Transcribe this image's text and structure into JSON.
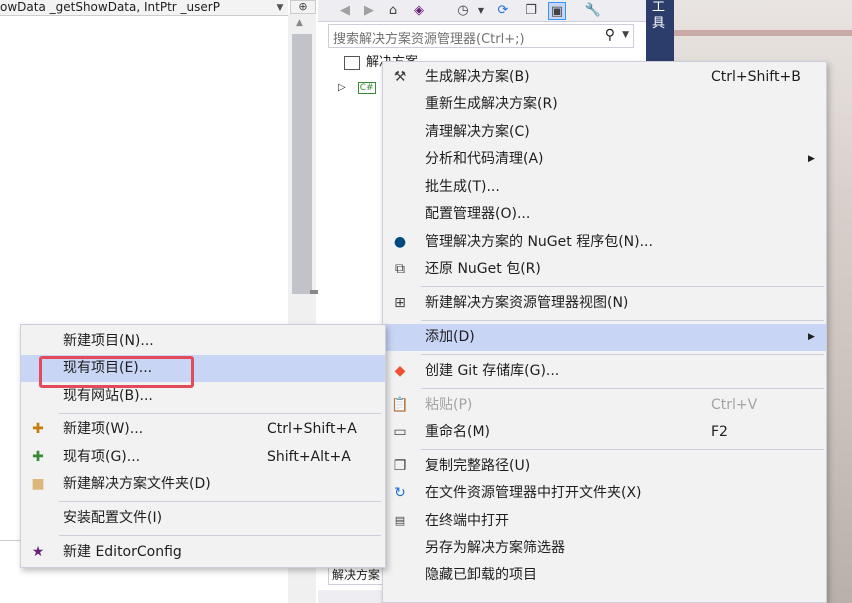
{
  "editor": {
    "code_text": "owData _getShowData, IntPtr _userP"
  },
  "solution_explorer": {
    "search_placeholder": "搜索解决方案资源管理器(Ctrl+;)",
    "tree_root_label": "解决方案 ...",
    "tree_child_badge": "C#",
    "bottom_tab_label": "解决方案"
  },
  "right_strip": {
    "text": "工具"
  },
  "main_menu": {
    "items": [
      {
        "label": "生成解决方案(B)",
        "shortcut": "Ctrl+Shift+B",
        "icon": "build-icon"
      },
      {
        "label": "重新生成解决方案(R)",
        "shortcut": ""
      },
      {
        "label": "清理解决方案(C)",
        "shortcut": ""
      },
      {
        "label": "分析和代码清理(A)",
        "shortcut": "",
        "submenu": true
      },
      {
        "label": "批生成(T)...",
        "shortcut": ""
      },
      {
        "label": "配置管理器(O)...",
        "shortcut": ""
      },
      {
        "label": "管理解决方案的 NuGet 程序包(N)...",
        "shortcut": "",
        "icon": "nuget-icon"
      },
      {
        "label": "还原 NuGet 包(R)",
        "shortcut": "",
        "icon": "restore-icon"
      },
      {
        "label": "新建解决方案资源管理器视图(N)",
        "shortcut": "",
        "icon": "new-view-icon"
      },
      {
        "label": "添加(D)",
        "shortcut": "",
        "submenu": true,
        "highlighted": true
      },
      {
        "label": "创建 Git 存储库(G)...",
        "shortcut": "",
        "icon": "git-icon"
      },
      {
        "label": "粘贴(P)",
        "shortcut": "Ctrl+V",
        "disabled": true,
        "icon": "paste-icon"
      },
      {
        "label": "重命名(M)",
        "shortcut": "F2",
        "icon": "rename-icon"
      },
      {
        "label": "复制完整路径(U)",
        "shortcut": "",
        "icon": "copy-icon"
      },
      {
        "label": "在文件资源管理器中打开文件夹(X)",
        "shortcut": "",
        "icon": "open-folder-icon"
      },
      {
        "label": "在终端中打开",
        "shortcut": "",
        "icon": "terminal-icon"
      },
      {
        "label": "另存为解决方案筛选器",
        "shortcut": ""
      },
      {
        "label": "隐藏已卸载的项目",
        "shortcut": ""
      }
    ]
  },
  "sub_menu": {
    "items": [
      {
        "label": "新建项目(N)...",
        "shortcut": ""
      },
      {
        "label": "现有项目(E)...",
        "shortcut": "",
        "highlighted": true
      },
      {
        "label": "现有网站(B)...",
        "shortcut": ""
      },
      {
        "label": "新建项(W)...",
        "shortcut": "Ctrl+Shift+A",
        "icon": "new-item-icon"
      },
      {
        "label": "现有项(G)...",
        "shortcut": "Shift+Alt+A",
        "icon": "existing-item-icon"
      },
      {
        "label": "新建解决方案文件夹(D)",
        "shortcut": "",
        "icon": "folder-icon"
      },
      {
        "label": "安装配置文件(I)",
        "shortcut": ""
      },
      {
        "label": "新建 EditorConfig",
        "shortcut": "",
        "icon": "editorconfig-icon"
      }
    ]
  },
  "colors": {
    "menu_bg": "#f2f2f2",
    "highlight": "#c9d5f5",
    "annotation_box": "#e34b5b",
    "strip": "#2d3d6b"
  }
}
